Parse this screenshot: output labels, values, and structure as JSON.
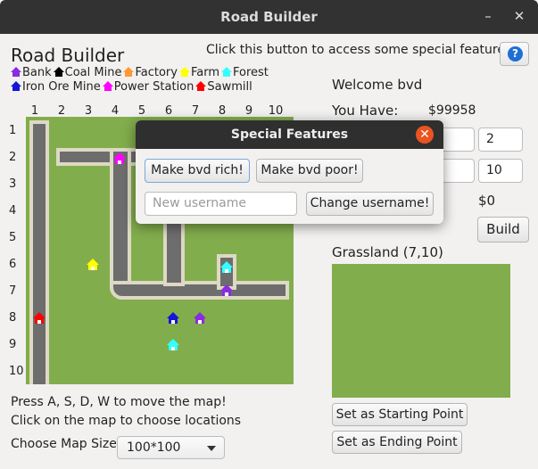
{
  "window": {
    "title": "Road Builder",
    "minimize_icon": "minimize-icon",
    "close_icon": "close-icon"
  },
  "app": {
    "heading": "Road Builder",
    "special_hint": "Click this button to access some special features!",
    "help_glyph": "?"
  },
  "legend": {
    "row1": [
      {
        "label": "Bank",
        "color": "#8a2be2"
      },
      {
        "label": "Coal Mine",
        "color": "#000000"
      },
      {
        "label": "Factory",
        "color": "#ff9933"
      },
      {
        "label": "Farm",
        "color": "#ffff00"
      },
      {
        "label": "Forest",
        "color": "#33ffff"
      }
    ],
    "row2": [
      {
        "label": "Iron Ore Mine",
        "color": "#1515d6"
      },
      {
        "label": "Power Station",
        "color": "#ff00ff"
      },
      {
        "label": "Sawmill",
        "color": "#ff0000"
      }
    ]
  },
  "map": {
    "columns": [
      "1",
      "2",
      "3",
      "4",
      "5",
      "6",
      "7",
      "8",
      "9",
      "10"
    ],
    "rows": [
      "1",
      "2",
      "3",
      "4",
      "5",
      "6",
      "7",
      "8",
      "9",
      "10"
    ],
    "background": "#82ad4c"
  },
  "instructions": {
    "line1": "Press A, S, D, W to move the map!",
    "line2": "Click on the map to choose locations",
    "map_size_label": "Choose Map Size:",
    "map_size_value": "100*100"
  },
  "panel": {
    "welcome": "Welcome bvd",
    "you_have_label": "You Have:",
    "money": "$99958",
    "field_a": "2",
    "field_b": "10",
    "cost": "$0",
    "build_label": "Build",
    "location": "Grassland (7,10)",
    "start_button": "Set as Starting Point",
    "end_button": "Set as Ending Point"
  },
  "dialog": {
    "title": "Special Features",
    "rich_button": "Make bvd rich!",
    "poor_button": "Make bvd poor!",
    "username_placeholder": "New username",
    "change_button": "Change username!"
  }
}
